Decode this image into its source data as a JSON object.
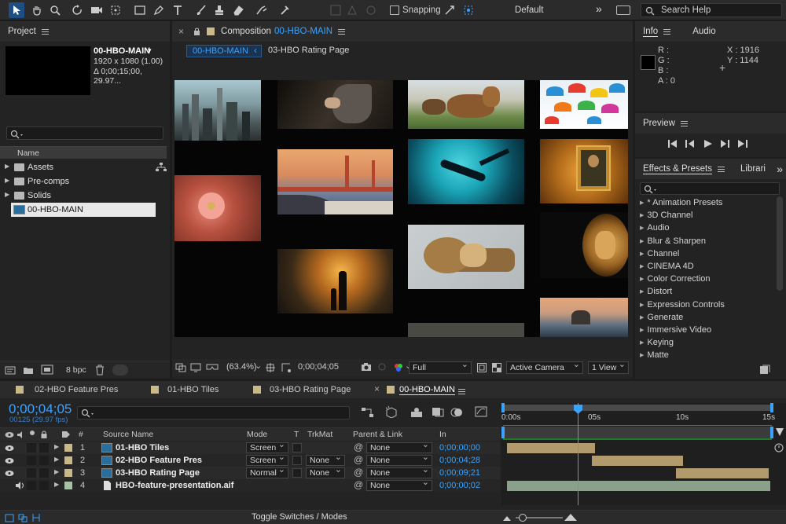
{
  "toolbar": {
    "snapping": "Snapping",
    "workspace": "Default",
    "search_help": "Search Help"
  },
  "project": {
    "title": "Project",
    "comp_name": "00-HBO-MAIN",
    "comp_info1": "1920 x 1080 (1.00)",
    "comp_info2": "Δ 0;00;15;00, 29.97...",
    "col_name": "Name",
    "items": [
      {
        "label": "Assets",
        "type": "folder"
      },
      {
        "label": "Pre-comps",
        "type": "folder"
      },
      {
        "label": "Solids",
        "type": "folder"
      },
      {
        "label": "00-HBO-MAIN",
        "type": "comp"
      }
    ],
    "bpc": "8 bpc"
  },
  "composition": {
    "title": "Composition",
    "comp_name": "00-HBO-MAIN",
    "breadcrumb_current": "00-HBO-MAIN",
    "breadcrumb_next": "03-HBO Rating Page",
    "zoom": "(63.4%)",
    "timecode": "0;00;04;05",
    "resolution": "Full",
    "camera": "Active Camera",
    "view": "1 View"
  },
  "info": {
    "tab_info": "Info",
    "tab_audio": "Audio",
    "r": "R :",
    "g": "G :",
    "b": "B :",
    "a": "A :  0",
    "x": "X : 1916",
    "y": "Y : 1144"
  },
  "preview": {
    "title": "Preview"
  },
  "effects": {
    "title": "Effects & Presets",
    "libraries": "Librari",
    "items": [
      "* Animation Presets",
      "3D Channel",
      "Audio",
      "Blur & Sharpen",
      "Channel",
      "CINEMA 4D",
      "Color Correction",
      "Distort",
      "Expression Controls",
      "Generate",
      "Immersive Video",
      "Keying",
      "Matte"
    ]
  },
  "timeline": {
    "tabs": [
      "02-HBO Feature Pres",
      "01-HBO Tiles",
      "03-HBO Rating Page",
      "00-HBO-MAIN"
    ],
    "timecode": "0;00;04;05",
    "frames": "00125 (29.97 fps)",
    "columns": {
      "num": "#",
      "source": "Source Name",
      "mode": "Mode",
      "t": "T",
      "trkmat": "TrkMat",
      "parent": "Parent & Link",
      "in": "In"
    },
    "layers": [
      {
        "num": "1",
        "name": "01-HBO Tiles",
        "mode": "Screen",
        "trkmat": "",
        "parent": "None",
        "in": "0;00;00;00"
      },
      {
        "num": "2",
        "name": "02-HBO Feature Pres",
        "mode": "Screen",
        "trkmat": "None",
        "parent": "None",
        "in": "0;00;04;28"
      },
      {
        "num": "3",
        "name": "03-HBO Rating Page",
        "mode": "Normal",
        "trkmat": "None",
        "parent": "None",
        "in": "0;00;09;21"
      },
      {
        "num": "4",
        "name": "HBO-feature-presentation.aif",
        "mode": "",
        "trkmat": "",
        "parent": "None",
        "in": "0;00;00;02"
      }
    ],
    "ruler": [
      "0:00s",
      "05s",
      "10s",
      "15s"
    ],
    "toggle": "Toggle Switches / Modes"
  },
  "colors": {
    "accent": "#3aa3ff",
    "comp_label": "#c8b88a",
    "bar_tan": "#b19a6c",
    "bar_green": "#8aa08a"
  }
}
